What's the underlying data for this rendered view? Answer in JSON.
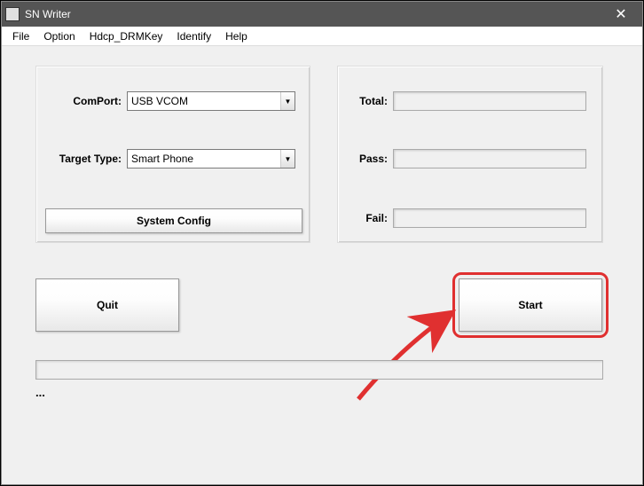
{
  "window": {
    "title": "SN Writer"
  },
  "menu": {
    "file": "File",
    "option": "Option",
    "hdcp": "Hdcp_DRMKey",
    "identify": "Identify",
    "help": "Help"
  },
  "left_panel": {
    "comport_label": "ComPort:",
    "comport_value": "USB VCOM",
    "target_label": "Target Type:",
    "target_value": "Smart Phone",
    "config_btn": "System Config"
  },
  "right_panel": {
    "total_label": "Total:",
    "total_value": "",
    "pass_label": "Pass:",
    "pass_value": "",
    "fail_label": "Fail:",
    "fail_value": ""
  },
  "buttons": {
    "quit": "Quit",
    "start": "Start"
  },
  "status": "..."
}
